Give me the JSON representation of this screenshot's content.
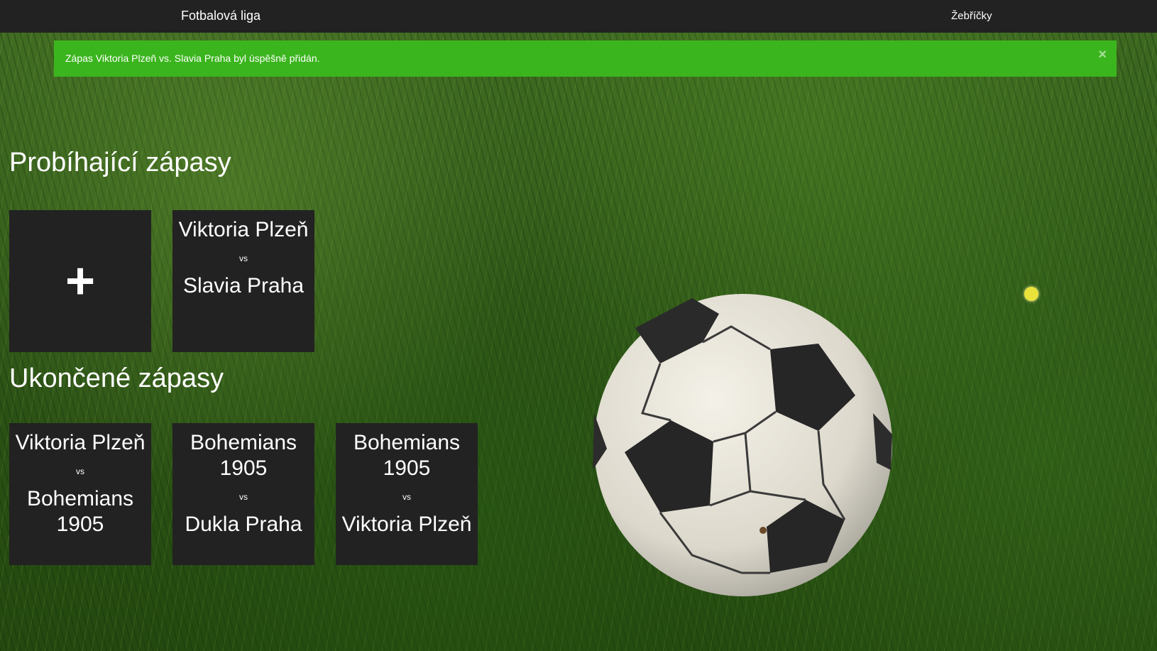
{
  "navbar": {
    "brand": "Fotbalová liga",
    "rankings_link": "Žebříčky"
  },
  "alert": {
    "message": "Zápas Viktoria Plzeň vs. Slavia Praha byl úspěšně přidán.",
    "close_symbol": "×",
    "color": "#3bb51e"
  },
  "ongoing": {
    "title": "Probíhající zápasy",
    "add_symbol": "+",
    "matches": [
      {
        "home": "Viktoria Plzeň",
        "vs": "vs",
        "away": "Slavia Praha"
      }
    ]
  },
  "finished": {
    "title": "Ukončené zápasy",
    "matches": [
      {
        "home": "Viktoria Plzeň",
        "vs": "vs",
        "away": "Bohemians 1905"
      },
      {
        "home": "Bohemians 1905",
        "vs": "vs",
        "away": "Dukla Praha"
      },
      {
        "home": "Bohemians 1905",
        "vs": "vs",
        "away": "Viktoria Plzeň"
      }
    ]
  },
  "colors": {
    "navbar": "#222222",
    "tile": "#222222",
    "text": "#ffffff"
  },
  "icons": {
    "add": "plus-icon",
    "close": "close-icon"
  }
}
